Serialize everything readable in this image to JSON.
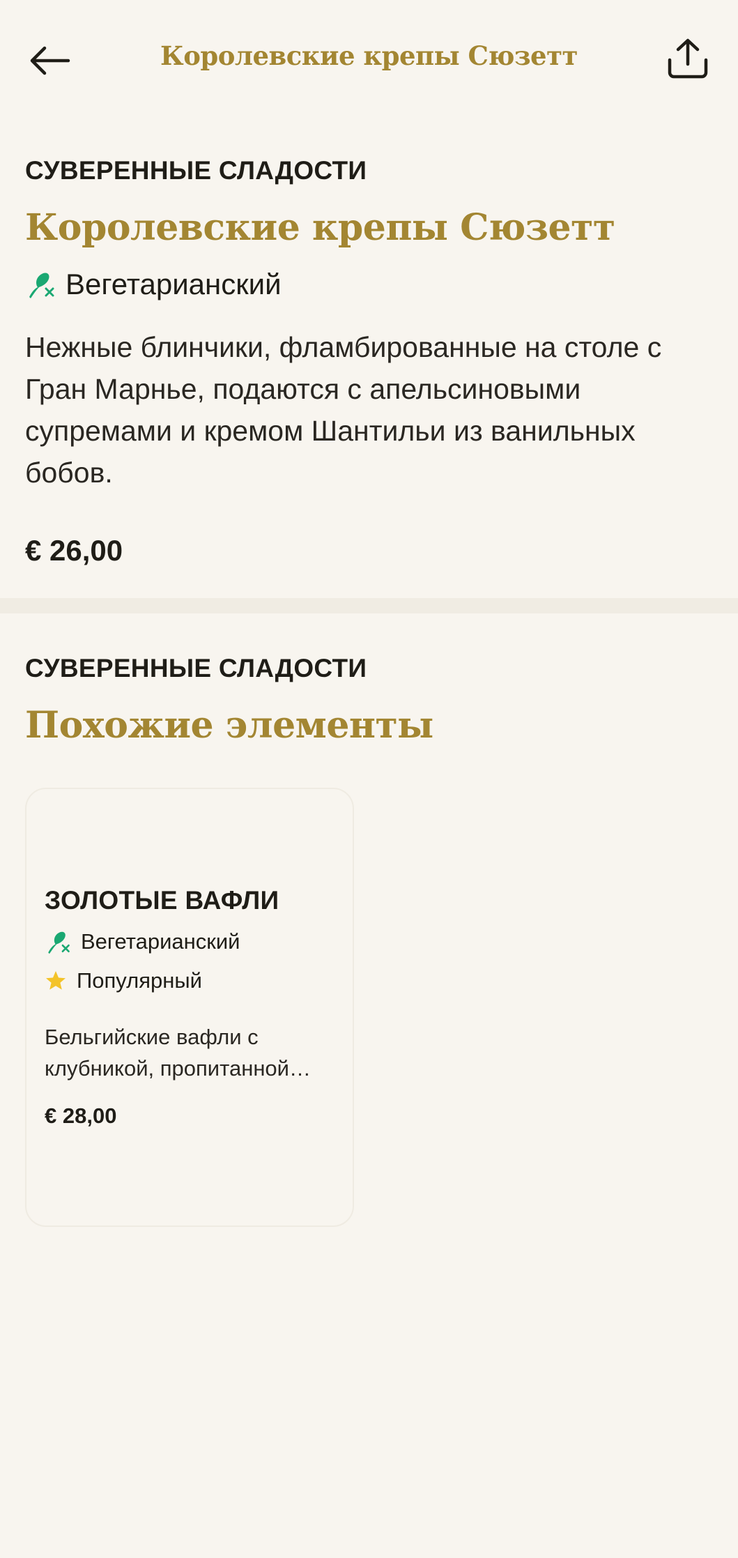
{
  "header": {
    "title": "Королевские крепы Сюзетт",
    "back_icon": "arrow-left-icon",
    "share_icon": "share-icon"
  },
  "item": {
    "category": "СУВЕРЕННЫЕ СЛАДОСТИ",
    "name": "Королевские крепы Сюзетт",
    "diet_label": "Вегетарианский",
    "diet_icon": "vegetarian-icon",
    "description": "Нежные блинчики, фламбированные на столе с Гран Марнье, подаются с апельсиновыми супремами и кремом Шантильи из ванильных бобов.",
    "price": "€ 26,00"
  },
  "similar": {
    "category": "СУВЕРЕННЫЕ СЛАДОСТИ",
    "title": "Похожие элементы",
    "items": [
      {
        "name": "ЗОЛОТЫЕ ВАФЛИ",
        "tags": [
          {
            "label": "Вегетарианский",
            "icon": "vegetarian-icon"
          },
          {
            "label": "Популярный",
            "icon": "star-icon"
          }
        ],
        "description": "Бельгийские вафли с клубникой, пропитанной…",
        "price": "€ 28,00"
      }
    ]
  },
  "colors": {
    "background": "#f8f5ef",
    "accent_gold": "#a38632",
    "vegetarian_green": "#1aa872",
    "star_yellow": "#f3c32a",
    "text": "#1f1d17"
  }
}
